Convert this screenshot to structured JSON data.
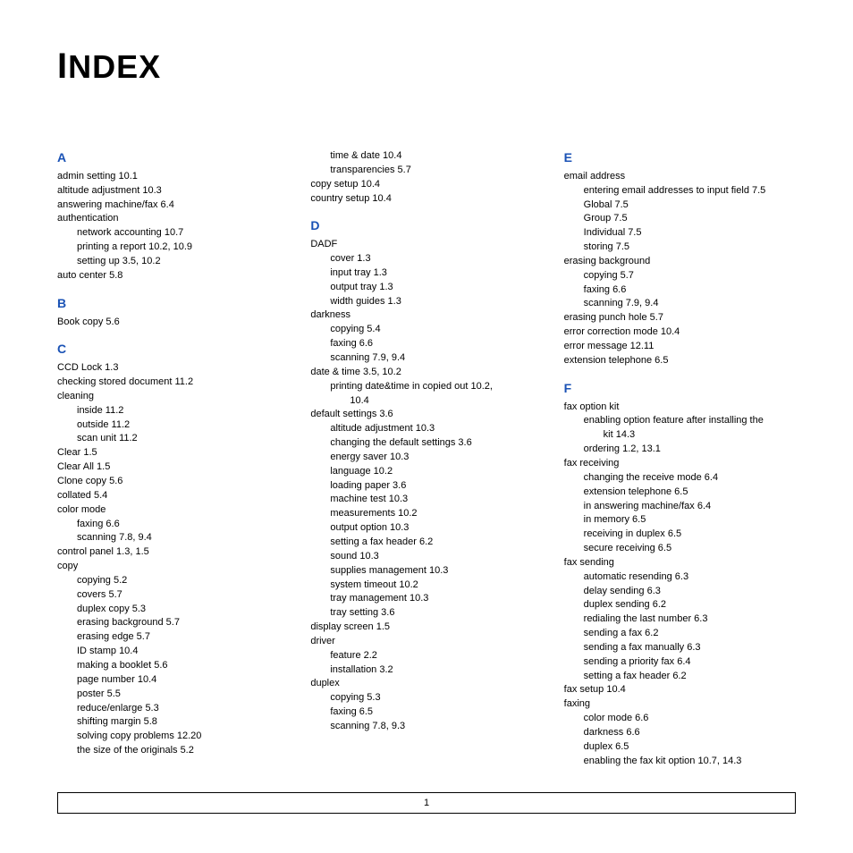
{
  "title_cap": "I",
  "title_rest": "NDEX",
  "page_number": "1",
  "columns": [
    {
      "blocks": [
        {
          "letter": "A",
          "lines": [
            {
              "t": "admin setting  10.1",
              "lvl": 0
            },
            {
              "t": "altitude adjustment  10.3",
              "lvl": 0
            },
            {
              "t": "answering machine/fax  6.4",
              "lvl": 0
            },
            {
              "t": "authentication",
              "lvl": 0
            },
            {
              "t": "network accounting  10.7",
              "lvl": 1
            },
            {
              "t": "printing a report  10.2, 10.9",
              "lvl": 1
            },
            {
              "t": "setting up  3.5, 10.2",
              "lvl": 1
            },
            {
              "t": "auto center  5.8",
              "lvl": 0
            }
          ]
        },
        {
          "letter": "B",
          "lines": [
            {
              "t": "Book copy  5.6",
              "lvl": 0
            }
          ]
        },
        {
          "letter": "C",
          "lines": [
            {
              "t": "CCD Lock  1.3",
              "lvl": 0
            },
            {
              "t": "checking stored document  11.2",
              "lvl": 0
            },
            {
              "t": "cleaning",
              "lvl": 0
            },
            {
              "t": "inside  11.2",
              "lvl": 1
            },
            {
              "t": "outside  11.2",
              "lvl": 1
            },
            {
              "t": "scan unit  11.2",
              "lvl": 1
            },
            {
              "t": "Clear  1.5",
              "lvl": 0
            },
            {
              "t": "Clear All  1.5",
              "lvl": 0
            },
            {
              "t": "Clone copy  5.6",
              "lvl": 0
            },
            {
              "t": "collated  5.4",
              "lvl": 0
            },
            {
              "t": "color mode",
              "lvl": 0
            },
            {
              "t": "faxing  6.6",
              "lvl": 1
            },
            {
              "t": "scanning  7.8, 9.4",
              "lvl": 1
            },
            {
              "t": "control panel  1.3, 1.5",
              "lvl": 0
            },
            {
              "t": "copy",
              "lvl": 0
            },
            {
              "t": "copying  5.2",
              "lvl": 1
            },
            {
              "t": "covers  5.7",
              "lvl": 1
            },
            {
              "t": "duplex copy  5.3",
              "lvl": 1
            },
            {
              "t": "erasing background  5.7",
              "lvl": 1
            },
            {
              "t": "erasing edge  5.7",
              "lvl": 1
            },
            {
              "t": "ID stamp  10.4",
              "lvl": 1
            },
            {
              "t": "making a booklet  5.6",
              "lvl": 1
            },
            {
              "t": "page number  10.4",
              "lvl": 1
            },
            {
              "t": "poster  5.5",
              "lvl": 1
            },
            {
              "t": "reduce/enlarge  5.3",
              "lvl": 1
            },
            {
              "t": "shifting margin  5.8",
              "lvl": 1
            },
            {
              "t": "solving copy problems  12.20",
              "lvl": 1
            },
            {
              "t": "the size of the originals  5.2",
              "lvl": 1
            }
          ]
        }
      ]
    },
    {
      "blocks": [
        {
          "letter": "",
          "lines": [
            {
              "t": "time & date  10.4",
              "lvl": 1
            },
            {
              "t": "transparencies  5.7",
              "lvl": 1
            },
            {
              "t": "copy setup  10.4",
              "lvl": 0
            },
            {
              "t": "country setup  10.4",
              "lvl": 0
            }
          ]
        },
        {
          "letter": "D",
          "lines": [
            {
              "t": "DADF",
              "lvl": 0
            },
            {
              "t": "cover  1.3",
              "lvl": 1
            },
            {
              "t": "input tray  1.3",
              "lvl": 1
            },
            {
              "t": "output tray  1.3",
              "lvl": 1
            },
            {
              "t": "width guides  1.3",
              "lvl": 1
            },
            {
              "t": "darkness",
              "lvl": 0
            },
            {
              "t": "copying  5.4",
              "lvl": 1
            },
            {
              "t": "faxing  6.6",
              "lvl": 1
            },
            {
              "t": "scanning  7.9, 9.4",
              "lvl": 1
            },
            {
              "t": "date & time  3.5, 10.2",
              "lvl": 0
            },
            {
              "t": "printing date&time in copied out  10.2, ",
              "lvl": 1
            },
            {
              "t": "10.4",
              "lvl": 2
            },
            {
              "t": "default settings  3.6",
              "lvl": 0
            },
            {
              "t": "altitude adjustment  10.3",
              "lvl": 1
            },
            {
              "t": "changing the default settings  3.6",
              "lvl": 1
            },
            {
              "t": "energy saver  10.3",
              "lvl": 1
            },
            {
              "t": "language  10.2",
              "lvl": 1
            },
            {
              "t": "loading paper  3.6",
              "lvl": 1
            },
            {
              "t": "machine test  10.3",
              "lvl": 1
            },
            {
              "t": "measurements  10.2",
              "lvl": 1
            },
            {
              "t": "output option  10.3",
              "lvl": 1
            },
            {
              "t": "setting a fax header  6.2",
              "lvl": 1
            },
            {
              "t": "sound  10.3",
              "lvl": 1
            },
            {
              "t": "supplies management  10.3",
              "lvl": 1
            },
            {
              "t": "system timeout  10.2",
              "lvl": 1
            },
            {
              "t": "tray management  10.3",
              "lvl": 1
            },
            {
              "t": "tray setting  3.6",
              "lvl": 1
            },
            {
              "t": "display screen  1.5",
              "lvl": 0
            },
            {
              "t": "driver",
              "lvl": 0
            },
            {
              "t": "feature  2.2",
              "lvl": 1
            },
            {
              "t": "installation  3.2",
              "lvl": 1
            },
            {
              "t": "duplex",
              "lvl": 0
            },
            {
              "t": "copying  5.3",
              "lvl": 1
            },
            {
              "t": "faxing  6.5",
              "lvl": 1
            },
            {
              "t": "scanning  7.8, 9.3",
              "lvl": 1
            }
          ]
        }
      ]
    },
    {
      "blocks": [
        {
          "letter": "E",
          "lines": [
            {
              "t": "email address",
              "lvl": 0
            },
            {
              "t": "entering email addresses to input field  7.5",
              "lvl": 1
            },
            {
              "t": "Global  7.5",
              "lvl": 1
            },
            {
              "t": "Group  7.5",
              "lvl": 1
            },
            {
              "t": "Individual  7.5",
              "lvl": 1
            },
            {
              "t": "storing  7.5",
              "lvl": 1
            },
            {
              "t": "erasing background",
              "lvl": 0
            },
            {
              "t": "copying  5.7",
              "lvl": 1
            },
            {
              "t": "faxing  6.6",
              "lvl": 1
            },
            {
              "t": "scanning  7.9, 9.4",
              "lvl": 1
            },
            {
              "t": "erasing punch hole  5.7",
              "lvl": 0
            },
            {
              "t": "error correction mode  10.4",
              "lvl": 0
            },
            {
              "t": "error message  12.11",
              "lvl": 0
            },
            {
              "t": "extension telephone  6.5",
              "lvl": 0
            }
          ]
        },
        {
          "letter": "F",
          "lines": [
            {
              "t": "fax option kit",
              "lvl": 0
            },
            {
              "t": "enabling option feature after installing the ",
              "lvl": 1
            },
            {
              "t": "kit  14.3",
              "lvl": 2
            },
            {
              "t": "ordering  1.2, 13.1",
              "lvl": 1
            },
            {
              "t": "fax receiving",
              "lvl": 0
            },
            {
              "t": "changing the receive mode  6.4",
              "lvl": 1
            },
            {
              "t": "extension telephone  6.5",
              "lvl": 1
            },
            {
              "t": "in answering machine/fax  6.4",
              "lvl": 1
            },
            {
              "t": "in memory  6.5",
              "lvl": 1
            },
            {
              "t": "receiving in duplex  6.5",
              "lvl": 1
            },
            {
              "t": "secure receiving  6.5",
              "lvl": 1
            },
            {
              "t": "fax sending",
              "lvl": 0
            },
            {
              "t": "automatic resending  6.3",
              "lvl": 1
            },
            {
              "t": "delay sending  6.3",
              "lvl": 1
            },
            {
              "t": "duplex sending  6.2",
              "lvl": 1
            },
            {
              "t": "redialing the last number  6.3",
              "lvl": 1
            },
            {
              "t": "sending a fax  6.2",
              "lvl": 1
            },
            {
              "t": "sending a fax manually  6.3",
              "lvl": 1
            },
            {
              "t": "sending a priority fax  6.4",
              "lvl": 1
            },
            {
              "t": "setting a fax header  6.2",
              "lvl": 1
            },
            {
              "t": "fax setup  10.4",
              "lvl": 0
            },
            {
              "t": "faxing",
              "lvl": 0
            },
            {
              "t": "color mode  6.6",
              "lvl": 1
            },
            {
              "t": "darkness  6.6",
              "lvl": 1
            },
            {
              "t": "duplex  6.5",
              "lvl": 1
            },
            {
              "t": "enabling the fax kit option  10.7, 14.3",
              "lvl": 1
            }
          ]
        }
      ]
    }
  ]
}
